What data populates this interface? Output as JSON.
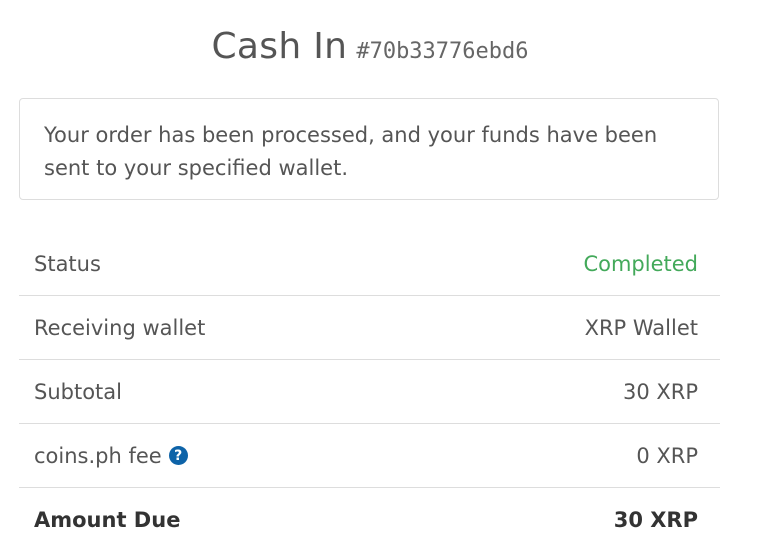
{
  "header": {
    "title": "Cash In",
    "order_id": "#70b33776ebd6"
  },
  "notice": {
    "text": "Your order has been processed, and your funds have been sent to your specified wallet."
  },
  "details": {
    "status": {
      "label": "Status",
      "value": "Completed"
    },
    "wallet": {
      "label": "Receiving wallet",
      "value": "XRP Wallet"
    },
    "subtotal": {
      "label": "Subtotal",
      "value": "30 XRP"
    },
    "fee": {
      "label": "coins.ph fee",
      "value": "0 XRP",
      "help_icon": "question-circle-icon",
      "help_glyph": "?"
    },
    "amount_due": {
      "label": "Amount Due",
      "value": "30 XRP"
    }
  },
  "colors": {
    "status_completed": "#43a95a",
    "help_icon_bg": "#0d63a8",
    "border": "#dddddd"
  }
}
